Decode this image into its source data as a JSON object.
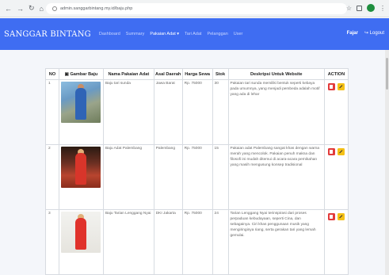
{
  "browser": {
    "url": "admin.sanggarbintang.my.id/baju.php"
  },
  "navbar": {
    "brand": "SANGGAR BINTANG",
    "menu": [
      "Dashboard",
      "Summary",
      "Pakaian Adat ▾",
      "Tari Adat",
      "Pelanggan",
      "User"
    ],
    "user": "Fajar",
    "logout": "Logout"
  },
  "table": {
    "headers": [
      "NO",
      "Gambar Baju",
      "Nama Pakaian Adat",
      "Asal Daerah",
      "Harga Sewa",
      "Stok",
      "Deskripsi Untuk Website",
      "ACTION"
    ],
    "rows": [
      {
        "no": "1",
        "nama": "Baju tari sunda",
        "asal": "Jawa Barat",
        "harga": "Rp. 75000",
        "stok": "30",
        "deskripsi": "Pakaian tari sunda memiliki bentuk seperti kebaya pada umumnya, yang menjadi pembeda adalah motif yang ada di lehar"
      },
      {
        "no": "2",
        "nama": "Baju Adat Palembang",
        "asal": "Palembang",
        "harga": "Rp. 75000",
        "stok": "15",
        "deskripsi": "Pakaian adat Palembang sangat khas dengan warna merah yang mencolok. Pakaian penuh makna dan filosofi ini mudah ditemui di acara-acara pernikahan yang masih mengusung konsep tradisional"
      },
      {
        "no": "3",
        "nama": "Baju Tarian Lenggang Nyai",
        "asal": "DKI Jakarta",
        "harga": "Rp. 75000",
        "stok": "24",
        "deskripsi": "Tarian Lenggang Nyai terinspirasi dari proses perpaduan kebudayaan, seperti Cina, dan sebagainya. Ciri khas penggunaan musik yang mengiringinya riang, serta gerakan tari yang lemah gemulai."
      }
    ]
  },
  "colors": {
    "navbar": "#3f6df2",
    "delete": "#e23b3b",
    "edit": "#f5c116"
  }
}
